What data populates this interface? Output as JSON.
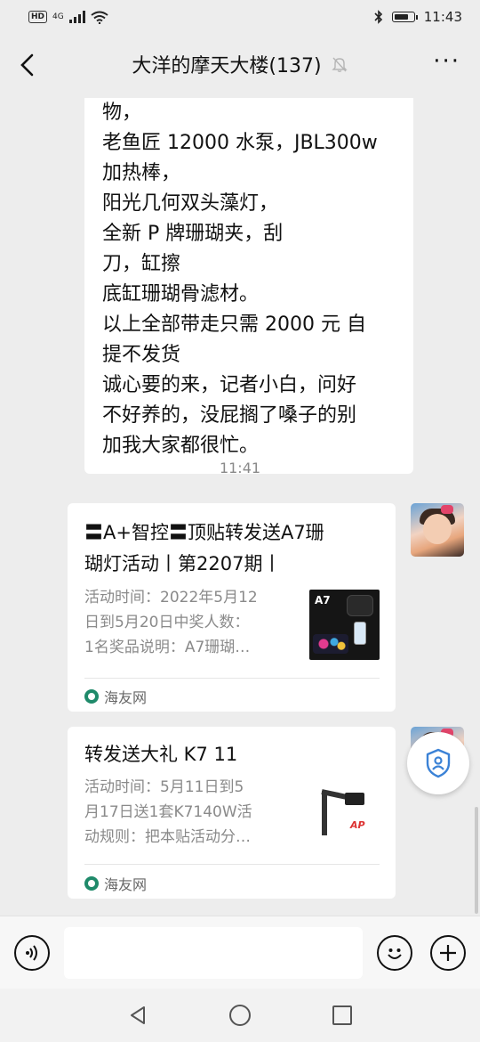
{
  "status_bar": {
    "hd_label": "HD",
    "network": "4G",
    "time": "11:43"
  },
  "header": {
    "title": "大洋的摩天大楼(137)",
    "back_icon": "chevron-left-icon",
    "mute_icon": "bell-off-icon",
    "more_label": "···"
  },
  "messages": {
    "text_message": {
      "lines": [
        "物，",
        "老鱼匠 12000 水泵，JBL300w",
        "加热棒，",
        "阳光几何双头藻灯，",
        "全新 P 牌珊瑚夹，刮",
        "刀，缸擦",
        "底缸珊瑚骨滤材。",
        "以上全部带走只需 2000 元 自",
        "提不发货",
        "诚心要的来，记者小白，问好",
        "不好养的，没屁搁了嗓子的别",
        "加我大家都很忙。"
      ]
    },
    "timestamp": "11:41",
    "card1": {
      "title_line1": "〓A+智控〓顶贴转发送A7珊",
      "title_line2": "瑚灯活动丨第2207期丨",
      "desc_line1": "活动时间：2022年5月12",
      "desc_line2": "日到5月20日中奖人数：",
      "desc_line3": "1名奖品说明：A7珊瑚…",
      "thumb_label": "A7",
      "source": "海友网"
    },
    "card2": {
      "title": "转发送大礼 K7 11",
      "desc_line1": "活动时间：5月11日到5",
      "desc_line2": "月17日送1套K7140W活",
      "desc_line3": "动规则：把本贴活动分…",
      "thumb_label": "AP",
      "source": "海友网"
    }
  },
  "input_bar": {
    "placeholder": ""
  }
}
